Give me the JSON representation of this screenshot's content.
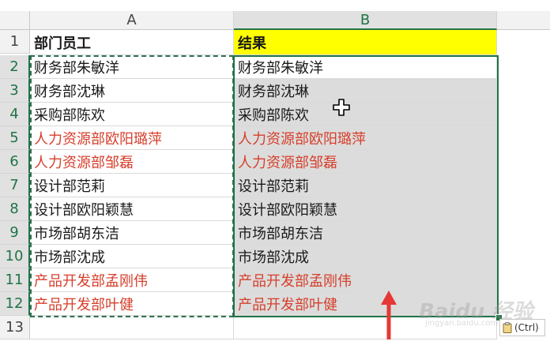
{
  "column_headers": [
    "A",
    "B"
  ],
  "row_numbers": [
    "1",
    "2",
    "3",
    "4",
    "5",
    "6",
    "7",
    "8",
    "9",
    "10",
    "11",
    "12",
    "13"
  ],
  "header_row": {
    "A": "部门员工",
    "B": "结果"
  },
  "rows": [
    {
      "A": "财务部朱敏洋",
      "B": "财务部朱敏洋"
    },
    {
      "A": "财务部沈琳",
      "B": "财务部沈琳"
    },
    {
      "A": "采购部陈欢",
      "B": "采购部陈欢"
    },
    {
      "A": "人力资源部欧阳璐萍",
      "B": "人力资源部欧阳璐萍"
    },
    {
      "A": "人力资源部邹磊",
      "B": "人力资源部邹磊"
    },
    {
      "A": "设计部范莉",
      "B": "设计部范莉"
    },
    {
      "A": "设计部欧阳颖慧",
      "B": "设计部欧阳颖慧"
    },
    {
      "A": "市场部胡东洁",
      "B": "市场部胡东洁"
    },
    {
      "A": "市场部沈成",
      "B": "市场部沈成"
    },
    {
      "A": "产品开发部孟刚伟",
      "B": "产品开发部孟刚伟"
    },
    {
      "A": "产品开发部叶健",
      "B": "产品开发部叶健"
    }
  ],
  "paste_options": {
    "label": "(Ctrl)"
  },
  "watermark": {
    "main": "Baidu 经验",
    "sub": "jingyan.baidu.com"
  },
  "colors": {
    "accent_green": "#217346",
    "red_text": "#d63f2b",
    "header_fill_yellow": "#ffff00",
    "arrow_red": "#e53935"
  },
  "icons": {
    "cursor": "cross-move-cursor-icon",
    "arrow": "up-arrow-icon",
    "paste": "clipboard-icon"
  }
}
